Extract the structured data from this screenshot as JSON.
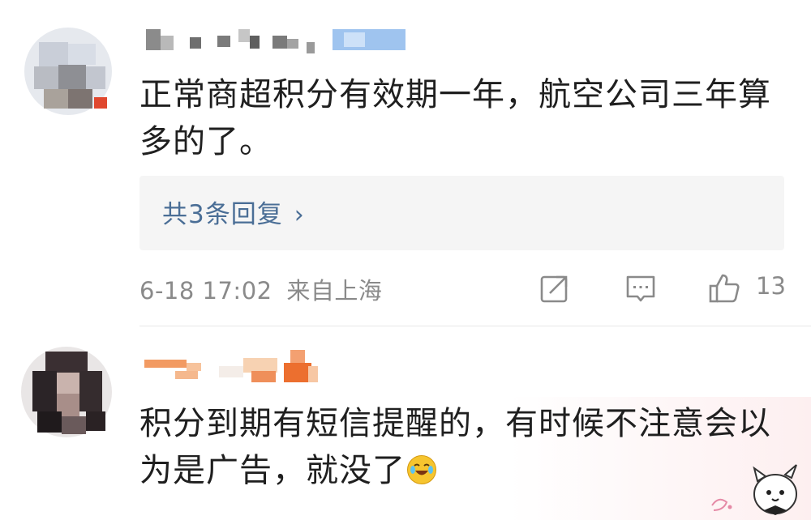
{
  "comments": [
    {
      "text": "正常商超积分有效期一年，航空公司三年算多的了。",
      "reply_link": "共3条回复",
      "timestamp": "6-18 17:02",
      "location": "来自上海",
      "like_count": "13"
    },
    {
      "text": "积分到期有短信提醒的，有时候不注意会以为是广告，就没了"
    }
  ],
  "icons": {
    "share": "share-icon",
    "comment": "comment-icon",
    "like": "thumbs-up-icon",
    "chevron": "chevron-right-icon",
    "emoji": "laughing-tears-emoji"
  },
  "colors": {
    "link": "#4a6e96",
    "meta": "#8a8a8a",
    "reply_bg": "#f5f5f5"
  }
}
